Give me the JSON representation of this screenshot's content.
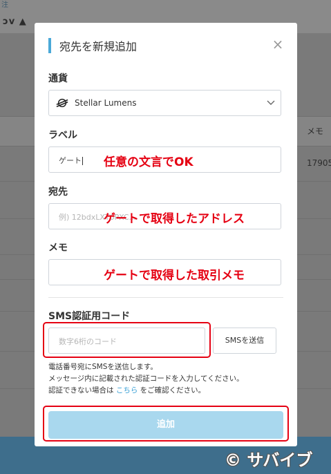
{
  "background": {
    "corner_text": "注",
    "header_text": "ɔv  ▲",
    "table_memo_header": "メモ",
    "table_memo_value": "17905"
  },
  "modal": {
    "title": "宛先を新規追加",
    "close_label": "×",
    "currency": {
      "label": "通貨",
      "selected": "Stellar Lumens",
      "icon": "stellar-lumens-icon"
    },
    "label_field": {
      "label": "ラベル",
      "value": "ゲート"
    },
    "destination": {
      "label": "宛先",
      "placeholder": "例) 12bdxLXT6PXC..."
    },
    "memo": {
      "label": "メモ"
    },
    "sms": {
      "label": "SMS認証用コード",
      "placeholder": "数字6桁のコード",
      "send_button": "SMSを送信"
    },
    "help": {
      "line1": "電話番号宛にSMSを送信します。",
      "line2": "メッセージ内に記載された認証コードを入力してください。",
      "line3_prefix": "認証できない場合は ",
      "line3_link": "こちら",
      "line3_suffix": " をご確認ください。"
    },
    "submit_label": "追加"
  },
  "annotations": {
    "label_note": "任意の文言でOK",
    "destination_note": "ゲートで取得したアドレス",
    "memo_note": "ゲートで取得した取引メモ"
  },
  "watermark": "© サバイブ",
  "colors": {
    "accent": "#4aa9d8",
    "submit_bg": "#a9d8ee",
    "annotation_red": "#e50012",
    "overlay": "#7a7a7a"
  }
}
